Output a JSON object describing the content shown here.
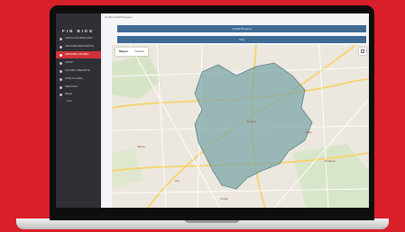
{
  "app": {
    "brand": "FIN BIKE",
    "breadcrumb": "Fin Bike Ciclabili Bergamo"
  },
  "sidebar": {
    "items": [
      {
        "label": "CARICA FILE BIKE & BICI",
        "active": false
      },
      {
        "label": "GESTIONE BIKESHARING",
        "active": false
      },
      {
        "label": "GESTIONE CICLABILI",
        "active": true
      },
      {
        "label": "UTENTI",
        "active": false
      },
      {
        "label": "CICLABILI PREFERITE",
        "active": false
      },
      {
        "label": "LISTA CICLABILI",
        "active": false
      },
      {
        "label": "RIEPILOGO",
        "active": false
      },
      {
        "label": "Mappa",
        "active": false
      },
      {
        "label": "Lista",
        "active": false
      }
    ]
  },
  "buttons": {
    "top": "Ciclabili Bergamo",
    "second": "Vista"
  },
  "map": {
    "tabs": [
      "Mappa",
      "Satellite"
    ],
    "active_tab": "Mappa",
    "labels": [
      "Bergamo",
      "Seriate",
      "Dalmine",
      "Treviglio",
      "Osio",
      "Brusaporto"
    ],
    "polygon_color": "#7fa7a9",
    "road_color": "#f7d26e",
    "accent": "#d0343a"
  }
}
